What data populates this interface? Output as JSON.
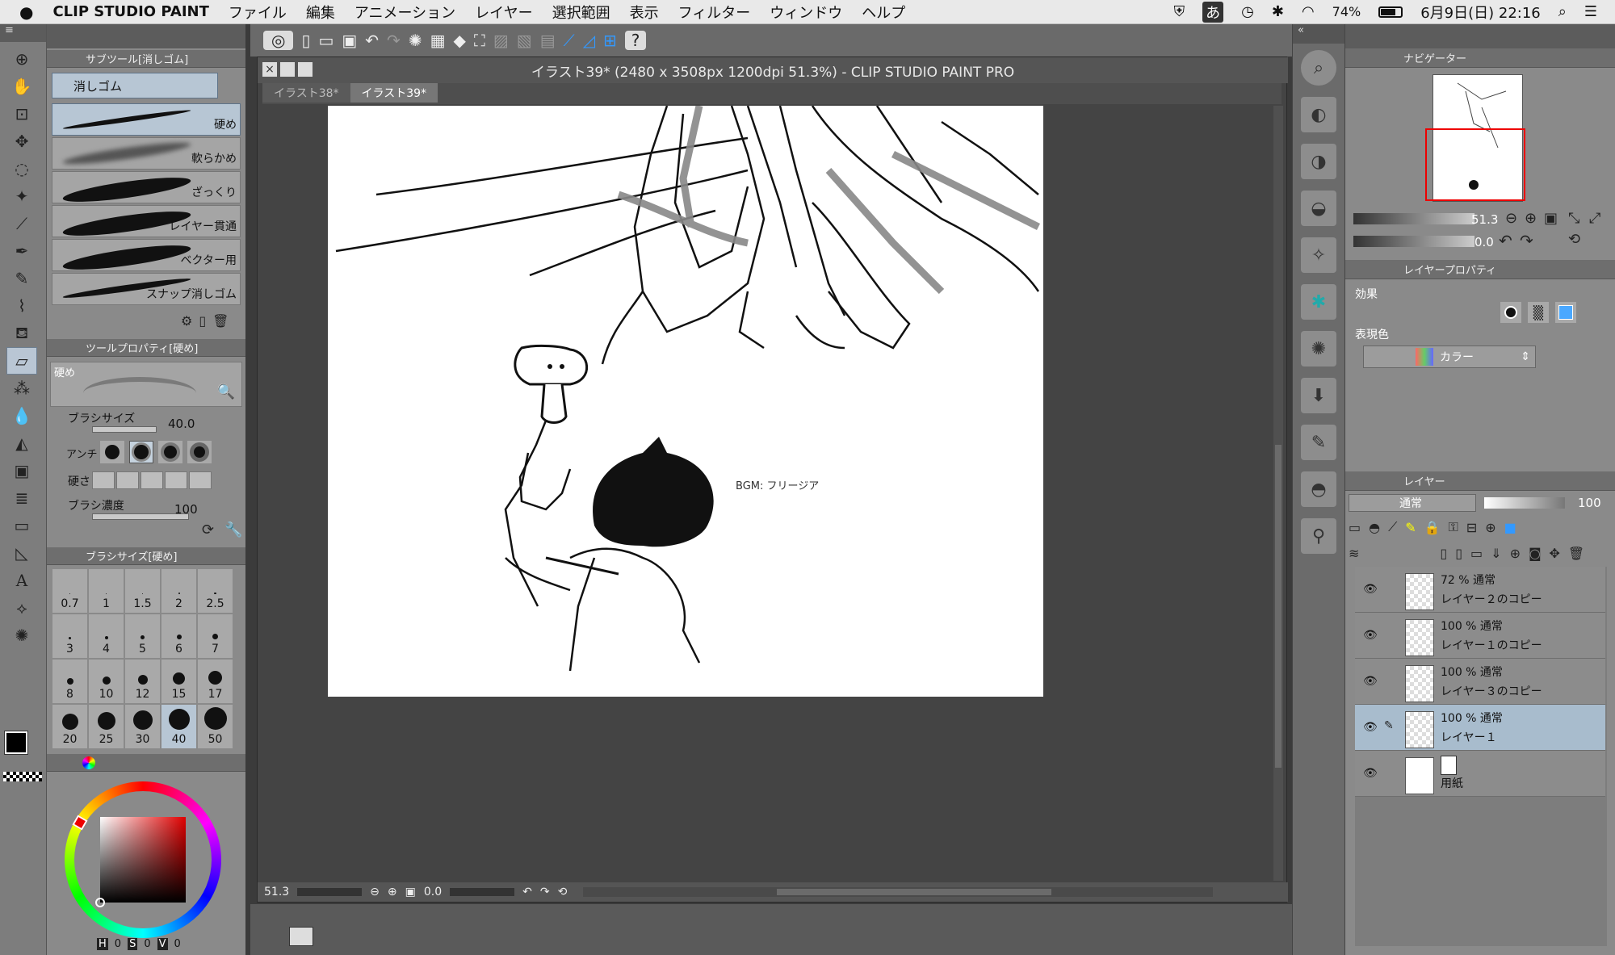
{
  "menubar": {
    "apple": "",
    "app": "CLIP STUDIO PAINT",
    "items": [
      "ファイル",
      "編集",
      "アニメーション",
      "レイヤー",
      "選択範囲",
      "表示",
      "フィルター",
      "ウィンドウ",
      "ヘルプ"
    ],
    "ime": "あ",
    "battery": "74%",
    "datetime": "6月9日(日) 22:16"
  },
  "window": {
    "title": "イラスト39* (2480 x 3508px 1200dpi 51.3%)  - CLIP STUDIO PAINT PRO"
  },
  "doc_tabs": [
    "イラスト38*",
    "イラスト39*"
  ],
  "subtool": {
    "header": "サブツール[消しゴム]",
    "group": "消しゴム",
    "brushes": [
      "硬め",
      "軟らかめ",
      "ざっくり",
      "レイヤー貫通",
      "ベクター用",
      "スナップ消しゴム"
    ]
  },
  "toolprop": {
    "header": "ツールプロパティ[硬め]",
    "preset": "硬め",
    "brush_size_label": "ブラシサイズ",
    "brush_size": "40.0",
    "anti_label": "アンチ",
    "hardness_label": "硬さ",
    "density_label": "ブラシ濃度",
    "density": "100"
  },
  "brushsize": {
    "header": "ブラシサイズ[硬め]",
    "sizes": [
      "0.7",
      "1",
      "1.5",
      "2",
      "2.5",
      "3",
      "4",
      "5",
      "6",
      "7",
      "8",
      "10",
      "12",
      "15",
      "17",
      "20",
      "25",
      "30",
      "40",
      "50"
    ]
  },
  "color": {
    "h_label": "H",
    "h": "0",
    "s_label": "S",
    "s": "0",
    "v_label": "V",
    "v": "0"
  },
  "navigator": {
    "header": "ナビゲーター",
    "zoom": "51.3",
    "angle": "0.0"
  },
  "layerprop": {
    "header": "レイヤープロパティ",
    "effect": "効果",
    "express_label": "表現色",
    "express_value": "カラー"
  },
  "layers": {
    "header": "レイヤー",
    "blend": "通常",
    "opacity": "100",
    "items": [
      {
        "mode": "72 % 通常",
        "name": "レイヤー２のコピー"
      },
      {
        "mode": "100 % 通常",
        "name": "レイヤー１のコピー"
      },
      {
        "mode": "100 % 通常",
        "name": "レイヤー３のコピー"
      },
      {
        "mode": "100 % 通常",
        "name": "レイヤー１"
      },
      {
        "mode": "",
        "name": "用紙"
      }
    ]
  },
  "canvas": {
    "text": "BGM: フリージア"
  },
  "statusbar": {
    "zoom": "51.3",
    "angle": "0.0"
  }
}
